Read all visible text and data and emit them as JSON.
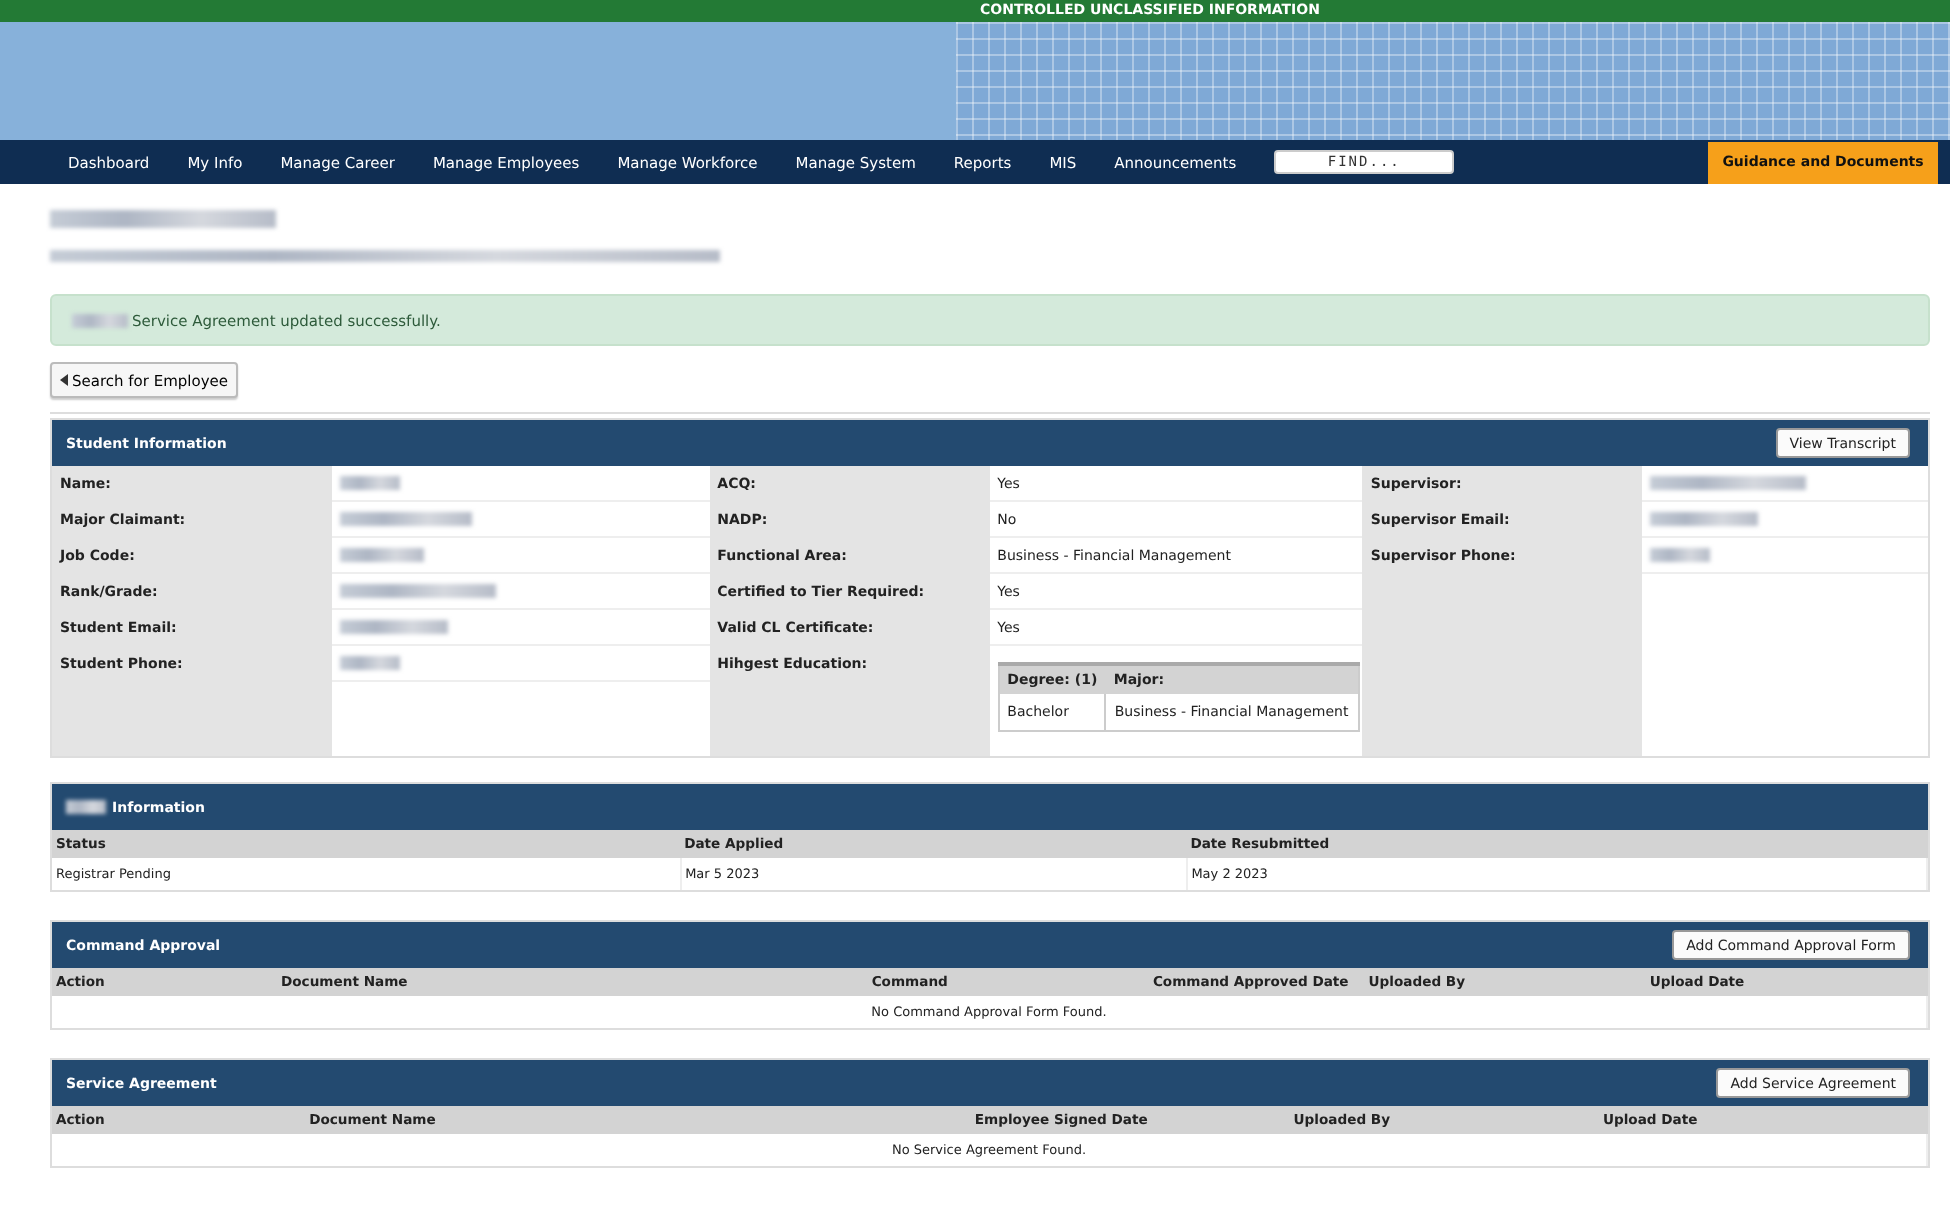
{
  "classification_banner": "CONTROLLED UNCLASSIFIED INFORMATION",
  "nav": {
    "items": [
      "Dashboard",
      "My Info",
      "Manage Career",
      "Manage Employees",
      "Manage Workforce",
      "Manage System",
      "Reports",
      "MIS",
      "Announcements"
    ],
    "search": {
      "placeholder": "FIND..."
    },
    "guidance_button": "Guidance and Documents"
  },
  "page_heading": {
    "redacted": true
  },
  "alert": {
    "text": "Service Agreement updated successfully.",
    "redacted_prefix": true
  },
  "back_button": "Search for Employee",
  "student_info": {
    "title": "Student Information",
    "button": "View Transcript",
    "groups": [
      {
        "fields": [
          {
            "label": "Name:",
            "redacted": true
          },
          {
            "label": "Major Claimant:",
            "redacted": true
          },
          {
            "label": "Job Code:",
            "redacted": true
          },
          {
            "label": "Rank/Grade:",
            "redacted": true
          },
          {
            "label": "Student Email:",
            "redacted": true
          },
          {
            "label": "Student Phone:",
            "redacted": true
          }
        ]
      },
      {
        "fields": [
          {
            "label": "ACQ:",
            "value": "Yes"
          },
          {
            "label": "NADP:",
            "value": "No"
          },
          {
            "label": "Functional Area:",
            "value": "Business - Financial Management"
          },
          {
            "label": "Certified to Tier Required:",
            "value": "Yes"
          },
          {
            "label": "Valid CL Certificate:",
            "value": "Yes"
          },
          {
            "label": "Hihgest Education:",
            "education": {
              "columns": [
                "Degree: (1)",
                "Major:"
              ],
              "rows": [
                [
                  "Bachelor",
                  "Business - Financial Management"
                ]
              ]
            }
          }
        ]
      },
      {
        "fields": [
          {
            "label": "Supervisor:",
            "redacted": true
          },
          {
            "label": "Supervisor Email:",
            "redacted": true
          },
          {
            "label": "Supervisor Phone:",
            "redacted": true
          }
        ]
      }
    ]
  },
  "panels": [
    {
      "title": "Information",
      "title_redacted_prefix": true,
      "columns": [
        "Status",
        "Date Applied",
        "Date Resubmitted"
      ],
      "rows": [
        [
          "Registrar Pending",
          "Mar 5 2023",
          "May 2 2023"
        ]
      ]
    },
    {
      "title": "Command Approval",
      "button": "Add Command Approval Form",
      "columns": [
        "Action",
        "Document Name",
        "Command",
        "Command Approved Date",
        "Uploaded By",
        "Upload Date"
      ],
      "empty": "No Command Approval Form Found."
    },
    {
      "title": "Service Agreement",
      "button": "Add Service Agreement",
      "columns": [
        "Action",
        "Document Name",
        "Employee Signed Date",
        "Uploaded By",
        "Upload Date"
      ],
      "empty": "No Service Agreement Found."
    }
  ]
}
